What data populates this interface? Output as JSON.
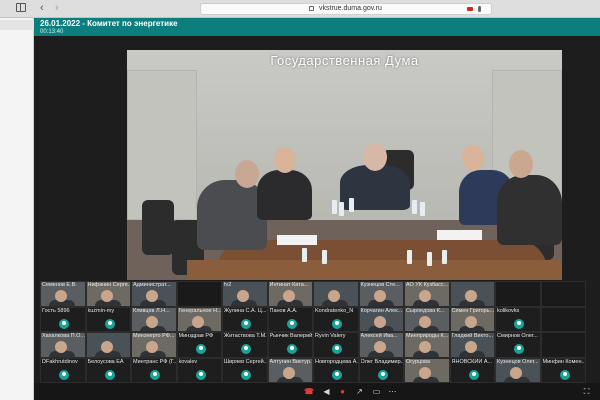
{
  "browser": {
    "url": "vkstrue.duma.gov.ru"
  },
  "meeting": {
    "title": "26.01.2022 - Комитет по энергетике",
    "timer": "00:13:40"
  },
  "main_video": {
    "overlay_title": "Государственная Дума"
  },
  "participants": [
    {
      "name": "Семенов Е.В.",
      "cam": "cam"
    },
    {
      "name": "Нифанин Серге...",
      "cam": "cam2"
    },
    {
      "name": "Администрат...",
      "cam": "cam3"
    },
    {
      "name": "",
      "cam": "empty"
    },
    {
      "name": "fv2",
      "cam": "cam3"
    },
    {
      "name": "Интинат Ката...",
      "cam": "cam2"
    },
    {
      "name": "",
      "cam": "cam3"
    },
    {
      "name": "Кузнецов Сте...",
      "cam": "cam"
    },
    {
      "name": "АО УК Кузбасс...",
      "cam": "cam2"
    },
    {
      "name": "",
      "cam": "cam3"
    },
    {
      "name": "",
      "cam": "empty"
    },
    {
      "name": "",
      "cam": "empty"
    },
    {
      "name": "Гость 5896",
      "cam": "avatar"
    },
    {
      "name": "kuzmin-my",
      "cam": "avatar"
    },
    {
      "name": "Кливцев Л.Н...",
      "cam": "cam"
    },
    {
      "name": "Генеральное Н...",
      "cam": "cam2"
    },
    {
      "name": "Жулина С.А. Ц...",
      "cam": "avatar"
    },
    {
      "name": "Панов А.А.",
      "cam": "avatar"
    },
    {
      "name": "Kondratenko_N",
      "cam": "avatar"
    },
    {
      "name": "Корчагин Алек...",
      "cam": "cam3"
    },
    {
      "name": "Сыроедова К...",
      "cam": "cam"
    },
    {
      "name": "Семен Григорь...",
      "cam": "cam2"
    },
    {
      "name": "kolikovks",
      "cam": "avatar"
    },
    {
      "name": "",
      "cam": "empty"
    },
    {
      "name": "Хахалкова П.О...",
      "cam": "cam"
    },
    {
      "name": "",
      "cam": "cam3"
    },
    {
      "name": "Минэнерго РФ...",
      "cam": "cam2"
    },
    {
      "name": "Минздрав РФ",
      "cam": "avatar"
    },
    {
      "name": "Житаствова Т.М...",
      "cam": "avatar"
    },
    {
      "name": "Рынчик Валерий",
      "cam": "avatar"
    },
    {
      "name": "Ryvin Valery",
      "cam": "avatar"
    },
    {
      "name": "Алексей Ива...",
      "cam": "cam"
    },
    {
      "name": "Минприроды К...",
      "cam": "cam2"
    },
    {
      "name": "Гладкий Викто...",
      "cam": "cam3"
    },
    {
      "name": "Смирнов Олег...",
      "cam": "avatar"
    },
    {
      "name": "",
      "cam": "empty"
    },
    {
      "name": "DFakhrutdinov",
      "cam": "avatar"
    },
    {
      "name": "Белоусова ЕА",
      "cam": "avatar"
    },
    {
      "name": "Минтранс РФ (Г...",
      "cam": "avatar"
    },
    {
      "name": "kovalev",
      "cam": "avatar"
    },
    {
      "name": "Ширяев Сергей...",
      "cam": "avatar"
    },
    {
      "name": "Алтунин Виктур...",
      "cam": "cam"
    },
    {
      "name": "Новгородцева А...",
      "cam": "avatar"
    },
    {
      "name": "Олег Владимир...",
      "cam": "avatar"
    },
    {
      "name": "Огурцова",
      "cam": "cam2"
    },
    {
      "name": "ЯНОВСКИЙ А...",
      "cam": "avatar"
    },
    {
      "name": "Кузнецов Олег...",
      "cam": "cam3"
    },
    {
      "name": "Минфин Комен...",
      "cam": "avatar"
    }
  ],
  "toolbar": {
    "hangup_icon": "phone-hangup-icon",
    "speaker_icon": "speaker-icon",
    "mic_icon": "mic-muted-icon",
    "share_icon": "share-icon",
    "screen_icon": "screen-icon",
    "more_icon": "more-icon",
    "fullscreen_icon": "fullscreen-icon"
  },
  "colors": {
    "header": "#0d7e7e",
    "avatar": "#19a39a",
    "hangup": "#e43b3b"
  }
}
